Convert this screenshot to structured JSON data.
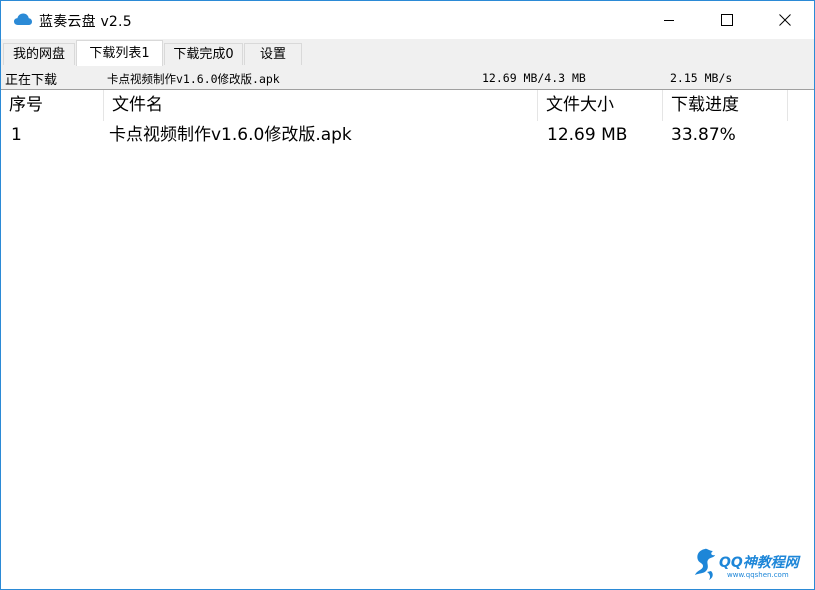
{
  "window": {
    "title": "蓝奏云盘 v2.5",
    "accent_color": "#2b8ad6",
    "app_icon": "cloud-icon",
    "controls": [
      "minimize-icon",
      "maximize-icon",
      "close-icon"
    ]
  },
  "tabs": [
    {
      "label": "我的网盘",
      "active": false
    },
    {
      "label": "下载列表1",
      "active": true
    },
    {
      "label": "下载完成0",
      "active": false
    },
    {
      "label": "设置",
      "active": false
    }
  ],
  "status": {
    "label": "正在下载",
    "file": "卡点视频制作v1.6.0修改版.apk",
    "size": "12.69 MB/4.3 MB",
    "speed": "2.15 MB/s"
  },
  "table": {
    "columns": [
      "序号",
      "文件名",
      "文件大小",
      "下载进度"
    ],
    "rows": [
      {
        "index": "1",
        "name": "卡点视频制作v1.6.0修改版.apk",
        "size": "12.69 MB",
        "progress": "33.87%"
      }
    ]
  },
  "watermark": {
    "brand": "QQ神教程网",
    "url": "www.qqshen.com",
    "icon": "dragon-logo-icon",
    "color": "#1d86d8"
  }
}
